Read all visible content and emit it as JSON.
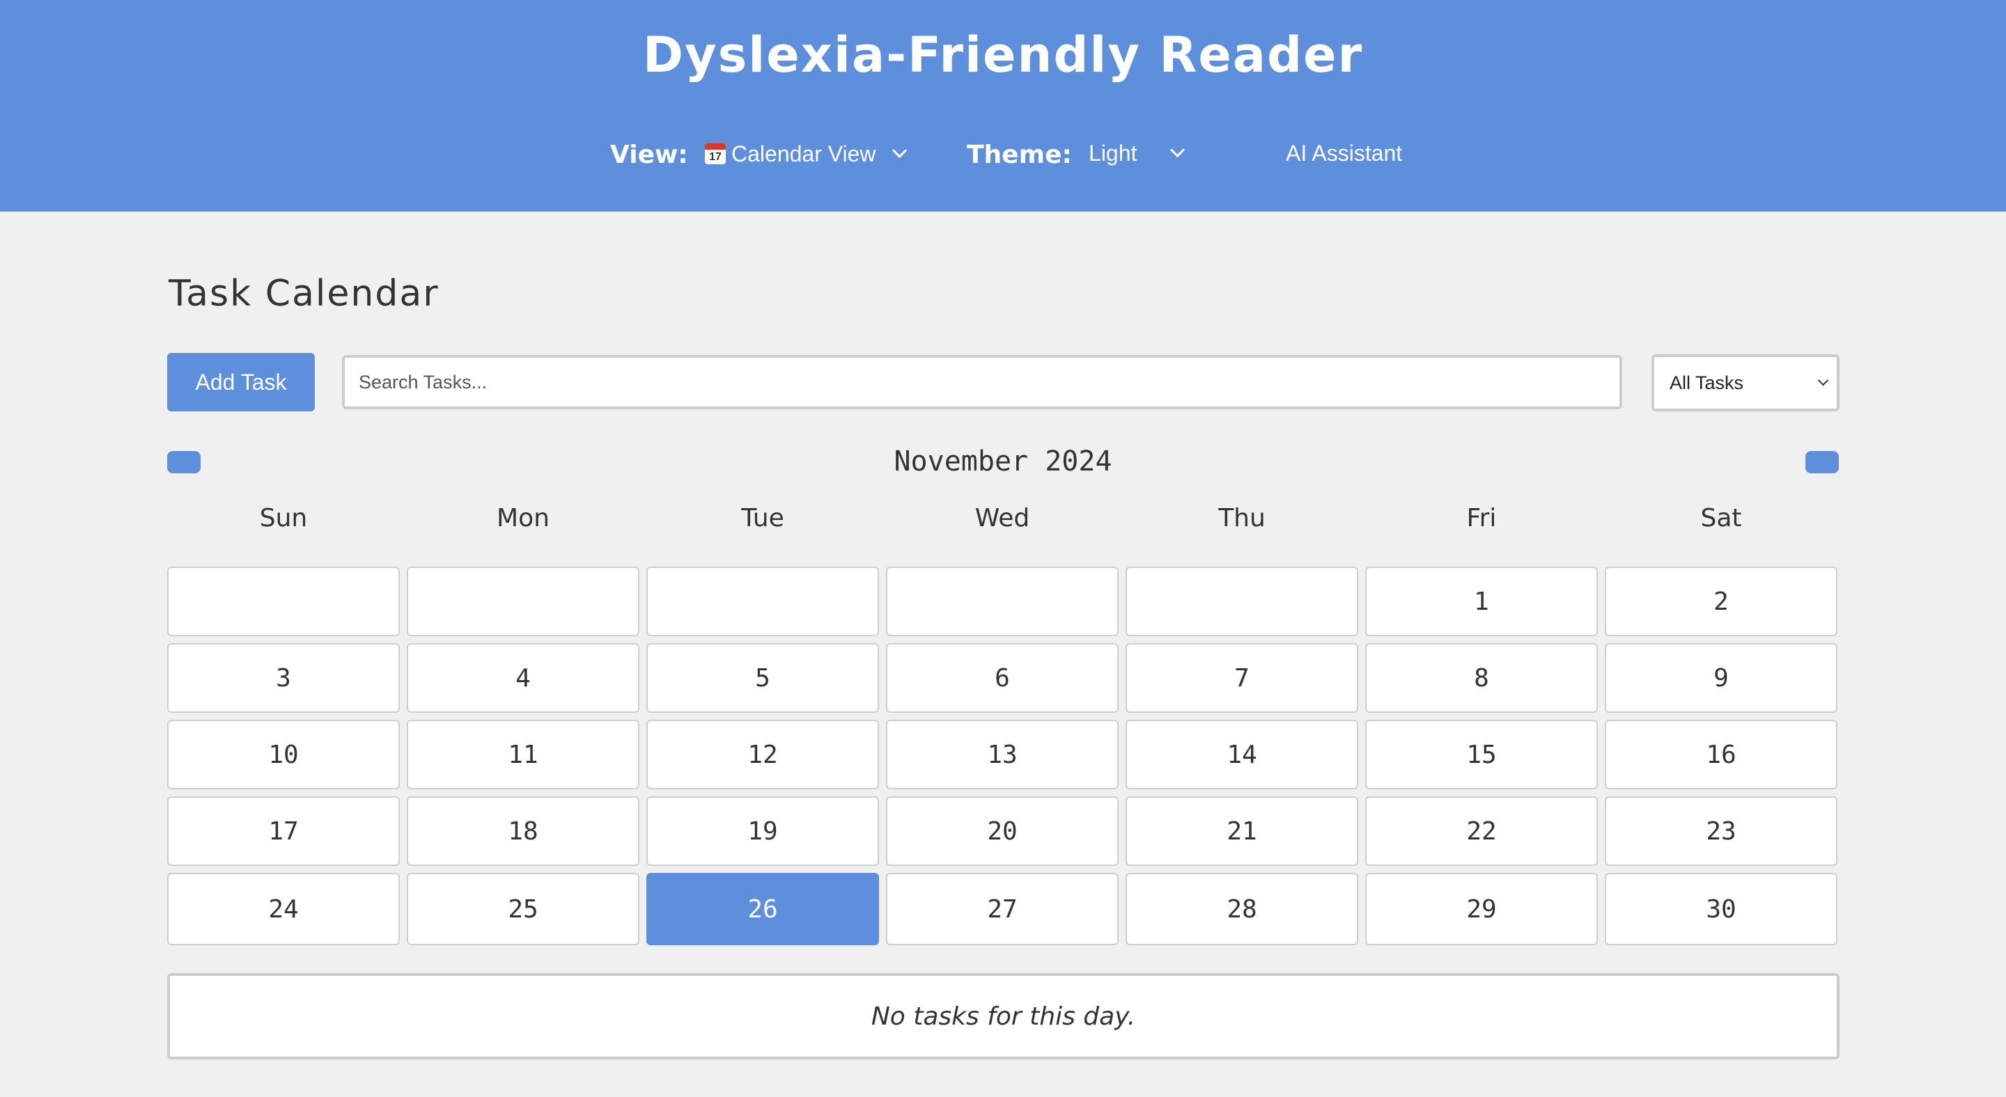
{
  "header": {
    "title": "Dyslexia-Friendly Reader",
    "view_label": "View:",
    "view_icon_day": "17",
    "view_value": "Calendar View",
    "theme_label": "Theme:",
    "theme_value": "Light",
    "ai_label": "AI Assistant",
    "colors": {
      "brand": "#5e8fdc",
      "text": "#ffffff"
    }
  },
  "main": {
    "title": "Task Calendar",
    "add_task_label": "Add Task",
    "search_placeholder": "Search Tasks...",
    "search_value": "",
    "filter_value": "All Tasks",
    "prev_icon": "chevron-left-icon",
    "next_icon": "chevron-right-icon"
  },
  "calendar": {
    "month_label": "November 2024",
    "weekdays": [
      "Sun",
      "Mon",
      "Tue",
      "Wed",
      "Thu",
      "Fri",
      "Sat"
    ],
    "weeks": [
      [
        "",
        "",
        "",
        "",
        "",
        "1",
        "2"
      ],
      [
        "3",
        "4",
        "5",
        "6",
        "7",
        "8",
        "9"
      ],
      [
        "10",
        "11",
        "12",
        "13",
        "14",
        "15",
        "16"
      ],
      [
        "17",
        "18",
        "19",
        "20",
        "21",
        "22",
        "23"
      ],
      [
        "24",
        "25",
        "26",
        "27",
        "28",
        "29",
        "30"
      ]
    ],
    "selected_day": "26"
  },
  "tasks": {
    "empty_message": "No tasks for this day."
  }
}
